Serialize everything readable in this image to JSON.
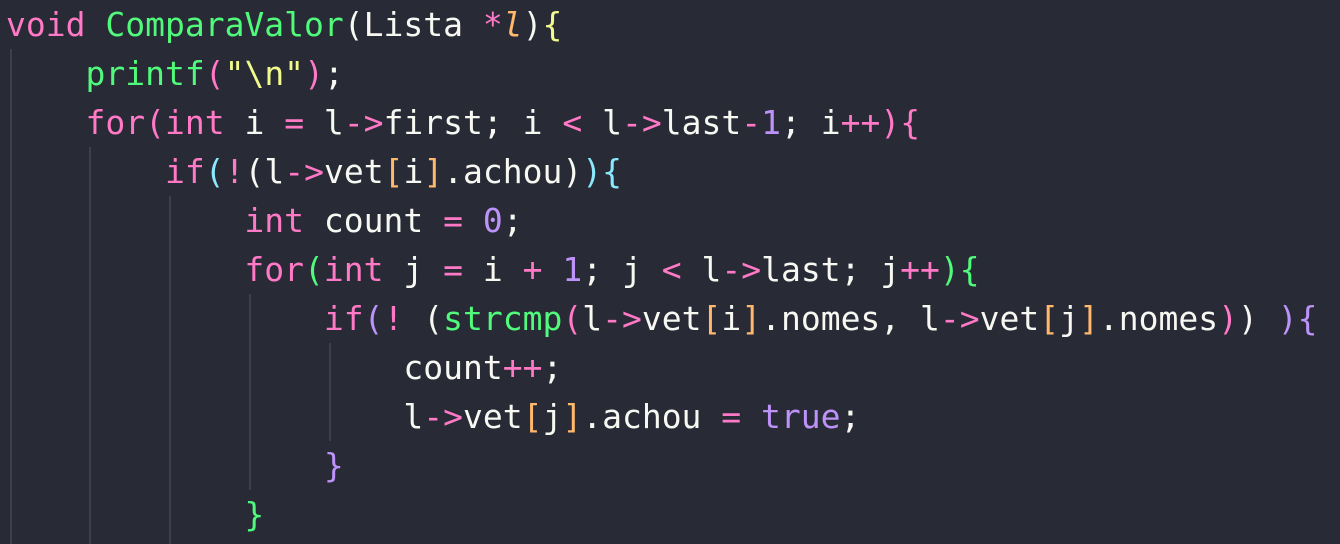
{
  "editor": {
    "lines": [
      [
        {
          "t": "void",
          "c": "void"
        },
        {
          "t": " ",
          "c": "ident"
        },
        {
          "t": "ComparaValor",
          "c": "func"
        },
        {
          "t": "(",
          "c": "paren1"
        },
        {
          "t": "Lista",
          "c": "ident"
        },
        {
          "t": " ",
          "c": "ident"
        },
        {
          "t": "*",
          "c": "op"
        },
        {
          "t": "l",
          "c": "param"
        },
        {
          "t": ")",
          "c": "paren1"
        },
        {
          "t": "{",
          "c": "brace1"
        }
      ],
      [
        {
          "t": "    ",
          "c": "ident"
        },
        {
          "t": "printf",
          "c": "func"
        },
        {
          "t": "(",
          "c": "paren2"
        },
        {
          "t": "\"\\n\"",
          "c": "string"
        },
        {
          "t": ")",
          "c": "paren2"
        },
        {
          "t": ";",
          "c": "punct"
        }
      ],
      [
        {
          "t": "    ",
          "c": "ident"
        },
        {
          "t": "for",
          "c": "keyword"
        },
        {
          "t": "(",
          "c": "paren2"
        },
        {
          "t": "int",
          "c": "type"
        },
        {
          "t": " i ",
          "c": "ident"
        },
        {
          "t": "=",
          "c": "op"
        },
        {
          "t": " l",
          "c": "ident"
        },
        {
          "t": "->",
          "c": "op"
        },
        {
          "t": "first; i ",
          "c": "ident"
        },
        {
          "t": "<",
          "c": "op"
        },
        {
          "t": " l",
          "c": "ident"
        },
        {
          "t": "->",
          "c": "op"
        },
        {
          "t": "last",
          "c": "ident"
        },
        {
          "t": "-",
          "c": "op"
        },
        {
          "t": "1",
          "c": "num"
        },
        {
          "t": "; i",
          "c": "ident"
        },
        {
          "t": "++",
          "c": "op"
        },
        {
          "t": ")",
          "c": "paren2"
        },
        {
          "t": "{",
          "c": "brace2"
        }
      ],
      [
        {
          "t": "        ",
          "c": "ident"
        },
        {
          "t": "if",
          "c": "keyword"
        },
        {
          "t": "(",
          "c": "paren3"
        },
        {
          "t": "!",
          "c": "op"
        },
        {
          "t": "(",
          "c": "paren1"
        },
        {
          "t": "l",
          "c": "ident"
        },
        {
          "t": "->",
          "c": "op"
        },
        {
          "t": "vet",
          "c": "ident"
        },
        {
          "t": "[",
          "c": "bracket"
        },
        {
          "t": "i",
          "c": "ident"
        },
        {
          "t": "]",
          "c": "bracket"
        },
        {
          "t": ".achou",
          "c": "ident"
        },
        {
          "t": ")",
          "c": "paren1"
        },
        {
          "t": ")",
          "c": "paren3"
        },
        {
          "t": "{",
          "c": "brace3"
        }
      ],
      [
        {
          "t": "            ",
          "c": "ident"
        },
        {
          "t": "int",
          "c": "type"
        },
        {
          "t": " count ",
          "c": "ident"
        },
        {
          "t": "=",
          "c": "op"
        },
        {
          "t": " ",
          "c": "ident"
        },
        {
          "t": "0",
          "c": "num"
        },
        {
          "t": ";",
          "c": "punct"
        }
      ],
      [
        {
          "t": "            ",
          "c": "ident"
        },
        {
          "t": "for",
          "c": "keyword"
        },
        {
          "t": "(",
          "c": "paren4"
        },
        {
          "t": "int",
          "c": "type"
        },
        {
          "t": " j ",
          "c": "ident"
        },
        {
          "t": "=",
          "c": "op"
        },
        {
          "t": " i ",
          "c": "ident"
        },
        {
          "t": "+",
          "c": "op"
        },
        {
          "t": " ",
          "c": "ident"
        },
        {
          "t": "1",
          "c": "num"
        },
        {
          "t": "; j ",
          "c": "ident"
        },
        {
          "t": "<",
          "c": "op"
        },
        {
          "t": " l",
          "c": "ident"
        },
        {
          "t": "->",
          "c": "op"
        },
        {
          "t": "last; j",
          "c": "ident"
        },
        {
          "t": "++",
          "c": "op"
        },
        {
          "t": ")",
          "c": "paren4"
        },
        {
          "t": "{",
          "c": "brace4"
        }
      ],
      [
        {
          "t": "                ",
          "c": "ident"
        },
        {
          "t": "if",
          "c": "keyword"
        },
        {
          "t": "(",
          "c": "paren5"
        },
        {
          "t": "!",
          "c": "op"
        },
        {
          "t": " ",
          "c": "ident"
        },
        {
          "t": "(",
          "c": "paren1"
        },
        {
          "t": "strcmp",
          "c": "func"
        },
        {
          "t": "(",
          "c": "paren2"
        },
        {
          "t": "l",
          "c": "ident"
        },
        {
          "t": "->",
          "c": "op"
        },
        {
          "t": "vet",
          "c": "ident"
        },
        {
          "t": "[",
          "c": "bracket"
        },
        {
          "t": "i",
          "c": "ident"
        },
        {
          "t": "]",
          "c": "bracket"
        },
        {
          "t": ".nomes, l",
          "c": "ident"
        },
        {
          "t": "->",
          "c": "op"
        },
        {
          "t": "vet",
          "c": "ident"
        },
        {
          "t": "[",
          "c": "bracket"
        },
        {
          "t": "j",
          "c": "ident"
        },
        {
          "t": "]",
          "c": "bracket"
        },
        {
          "t": ".nomes",
          "c": "ident"
        },
        {
          "t": ")",
          "c": "paren2"
        },
        {
          "t": ")",
          "c": "paren1"
        },
        {
          "t": " ",
          "c": "ident"
        },
        {
          "t": ")",
          "c": "paren5"
        },
        {
          "t": "{",
          "c": "brace5"
        }
      ],
      [
        {
          "t": "                    ",
          "c": "ident"
        },
        {
          "t": "count",
          "c": "ident"
        },
        {
          "t": "++",
          "c": "op"
        },
        {
          "t": ";",
          "c": "punct"
        }
      ],
      [
        {
          "t": "                    ",
          "c": "ident"
        },
        {
          "t": "l",
          "c": "ident"
        },
        {
          "t": "->",
          "c": "op"
        },
        {
          "t": "vet",
          "c": "ident"
        },
        {
          "t": "[",
          "c": "bracket"
        },
        {
          "t": "j",
          "c": "ident"
        },
        {
          "t": "]",
          "c": "bracket"
        },
        {
          "t": ".achou ",
          "c": "ident"
        },
        {
          "t": "=",
          "c": "op"
        },
        {
          "t": " ",
          "c": "ident"
        },
        {
          "t": "true",
          "c": "bool"
        },
        {
          "t": ";",
          "c": "punct"
        }
      ],
      [
        {
          "t": "                ",
          "c": "ident"
        },
        {
          "t": "}",
          "c": "brace5"
        }
      ],
      [
        {
          "t": "            ",
          "c": "ident"
        },
        {
          "t": "}",
          "c": "brace4"
        }
      ]
    ]
  }
}
